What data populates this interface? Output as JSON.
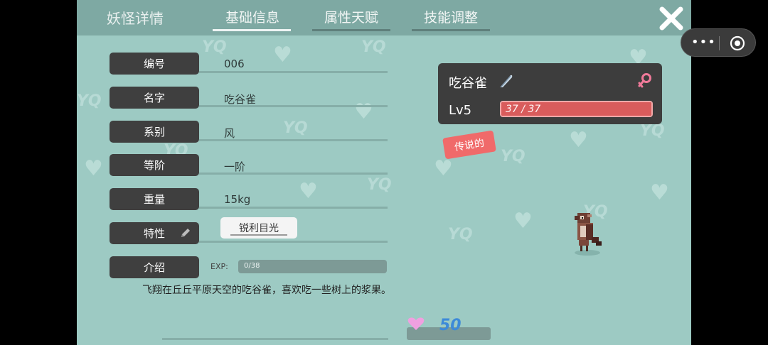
{
  "header": {
    "title": "妖怪详情",
    "tabs": [
      {
        "label": "基础信息",
        "active": true
      },
      {
        "label": "属性天赋",
        "active": false
      },
      {
        "label": "技能调整",
        "active": false
      }
    ],
    "close_icon": "close-icon"
  },
  "info": {
    "rows": [
      {
        "label": "编号",
        "value": "006"
      },
      {
        "label": "名字",
        "value": "吃谷雀"
      },
      {
        "label": "系别",
        "value": "风"
      },
      {
        "label": "等阶",
        "value": "一阶"
      },
      {
        "label": "重量",
        "value": "15kg"
      },
      {
        "label": "特性",
        "value": "锐利目光"
      },
      {
        "label": "介绍",
        "value": ""
      }
    ],
    "exp_label": "EXP:",
    "exp_text": "0/38",
    "exp_fraction": 0,
    "description": "飞翔在丘丘平原天空的吃谷雀，喜欢吃一些树上的浆果。"
  },
  "monster": {
    "name": "吃谷雀",
    "level": "Lv5",
    "hp_text": "37 / 37",
    "hp_fraction": 1,
    "rarity": "传说的",
    "gender_icon": "female-icon",
    "element_icon": "feather-icon"
  },
  "currency": {
    "amount": "50",
    "icon": "heart-icon"
  },
  "miniprogram": {
    "more_icon": "more-dots-icon",
    "close_icon": "target-circle-icon"
  },
  "colors": {
    "background": "#9dcac3",
    "topbar": "#7ea9a3",
    "label_button": "#3f3f3f",
    "hp": "#d95c5c",
    "rarity": "#f06a6a",
    "currency_number": "#3d8ad8"
  }
}
